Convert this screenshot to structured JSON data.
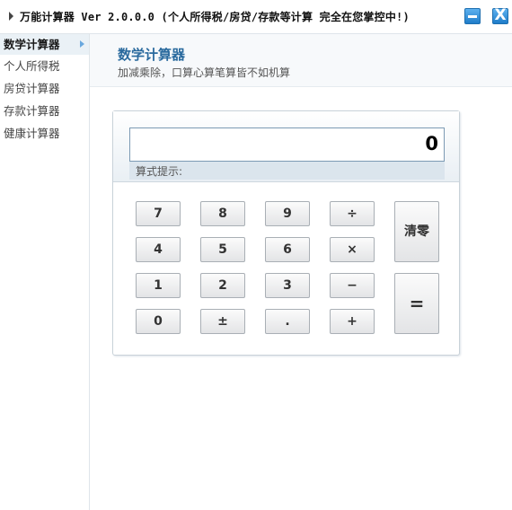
{
  "window": {
    "title": "万能计算器 Ver 2.0.0.0 (个人所得税/房贷/存款等计算 完全在您掌控中!)",
    "minimize_icon": "minimize-icon",
    "close_icon": "close-icon",
    "close_glyph": "X"
  },
  "sidebar": {
    "items": [
      {
        "label": "数学计算器",
        "active": true
      },
      {
        "label": "个人所得税",
        "active": false
      },
      {
        "label": "房贷计算器",
        "active": false
      },
      {
        "label": "存款计算器",
        "active": false
      },
      {
        "label": "健康计算器",
        "active": false
      }
    ]
  },
  "header": {
    "title": "数学计算器",
    "subtitle": "加减乘除，口算心算笔算皆不如机算"
  },
  "calculator": {
    "display_value": "0",
    "hint_label": "算式提示:",
    "keys": {
      "k7": "7",
      "k8": "8",
      "k9": "9",
      "div": "÷",
      "k4": "4",
      "k5": "5",
      "k6": "6",
      "mul": "×",
      "k1": "1",
      "k2": "2",
      "k3": "3",
      "sub": "−",
      "k0": "0",
      "sign": "±",
      "dot": ".",
      "add": "+",
      "clear": "清零",
      "equals": "="
    }
  },
  "colors": {
    "accent": "#2a6a9e",
    "window_button": "#1f7cc9",
    "sidebar_active_bg": "#eaf1f6"
  }
}
